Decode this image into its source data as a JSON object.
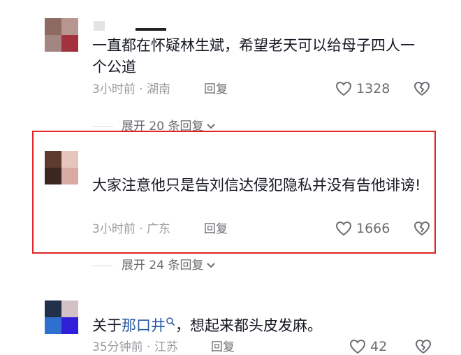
{
  "colors": {
    "highlight": "#e02325",
    "link": "#2d5aa6",
    "meta": "#9a9ba0"
  },
  "comments": [
    {
      "text": "一直都在怀疑林生斌，希望老天可以给母子四人一个公道",
      "time": "3小时前",
      "location": "湖南",
      "reply": "回复",
      "likes": "1328",
      "expand": "展开 20 条回复"
    },
    {
      "text": "大家注意他只是告刘信达侵犯隐私并没有告他诽谤!",
      "time": "3小时前",
      "location": "广东",
      "reply": "回复",
      "likes": "1666",
      "expand": "展开 24 条回复"
    },
    {
      "text_prefix": "关于",
      "link": "那口井",
      "text_suffix": "，想起来都头皮发麻。",
      "time": "35分钟前",
      "location": "江苏",
      "reply": "回复",
      "likes": "42"
    }
  ],
  "separator": "·",
  "icons": {
    "like": "heart-outline-icon",
    "dislike": "broken-heart-icon",
    "expand": "chevron-down-icon",
    "search": "search-icon"
  }
}
